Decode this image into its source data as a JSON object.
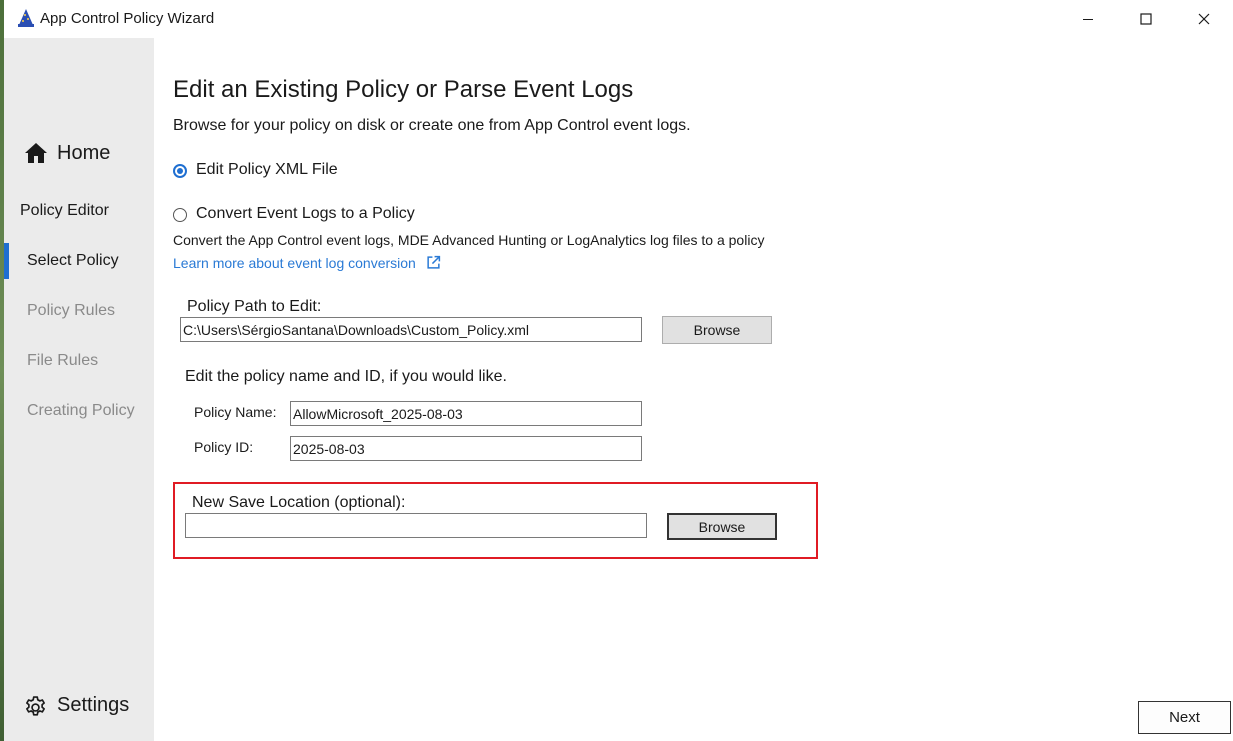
{
  "window": {
    "title": "App Control Policy Wizard"
  },
  "titlebar": {
    "app_icon": "wizard-hat-icon",
    "buttons": [
      "minimize-icon",
      "maximize-icon",
      "close-icon"
    ]
  },
  "sidebar": {
    "home": {
      "label": "Home",
      "icon": "home-icon"
    },
    "section": "Policy Editor",
    "items": [
      {
        "label": "Select Policy",
        "active": true
      },
      {
        "label": "Policy Rules",
        "active": false
      },
      {
        "label": "File Rules",
        "active": false
      },
      {
        "label": "Creating Policy",
        "active": false
      }
    ],
    "settings": {
      "label": "Settings",
      "icon": "gear-icon"
    }
  },
  "main": {
    "title": "Edit an Existing Policy or Parse Event Logs",
    "subtitle": "Browse for your policy on disk or create one from App Control event logs.",
    "options": [
      {
        "label": "Edit Policy XML File",
        "checked": true
      },
      {
        "label": "Convert Event Logs to a Policy",
        "checked": false
      }
    ],
    "convert_description": "Convert the App Control event logs, MDE Advanced Hunting or LogAnalytics log files to a policy",
    "learn_more_link": "Learn more about event log conversion",
    "link_icon": "external-link-icon",
    "policy_path": {
      "label": "Policy Path to Edit:",
      "value": "C:\\Users\\SérgioSantana\\Downloads\\Custom_Policy.xml",
      "browse_label": "Browse"
    },
    "name_id_prompt": "Edit the policy name and ID, if you would like.",
    "policy_name": {
      "label": "Policy Name:",
      "value": "AllowMicrosoft_2025-08-03"
    },
    "policy_id": {
      "label": "Policy ID:",
      "value": "2025-08-03"
    },
    "save_location": {
      "label": "New Save Location (optional):",
      "value": "",
      "browse_label": "Browse"
    }
  },
  "footer": {
    "next_label": "Next"
  },
  "colors": {
    "accent": "#1f6fd1",
    "highlight": "#e01b24",
    "link": "#2a7ad5",
    "sidebar_bg": "#ebebeb"
  }
}
